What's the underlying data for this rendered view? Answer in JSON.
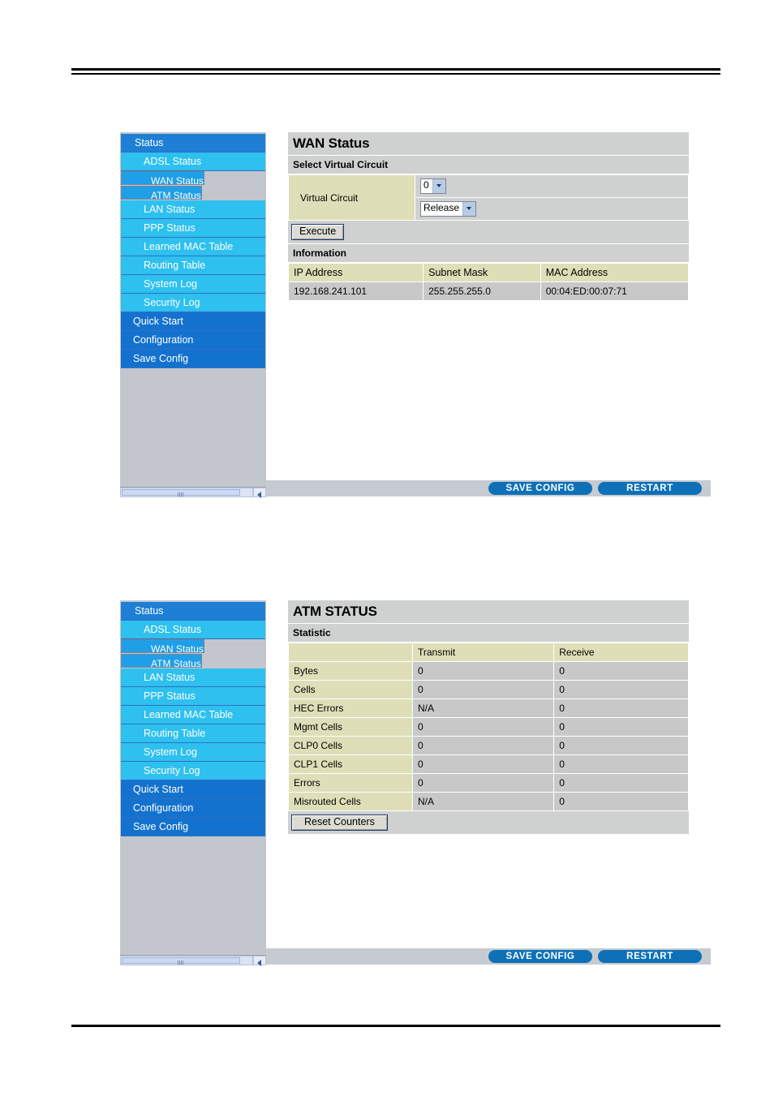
{
  "sidebar": {
    "items": [
      {
        "label": "Status",
        "level": 0,
        "selected": false
      },
      {
        "label": "ADSL Status",
        "level": 1,
        "selected": false
      },
      {
        "label": "WAN Status",
        "level": 1,
        "selected": true
      },
      {
        "label": "ATM Status",
        "level": 1,
        "selected": true
      },
      {
        "label": "LAN Status",
        "level": 1,
        "selected": false
      },
      {
        "label": "PPP Status",
        "level": 1,
        "selected": false
      },
      {
        "label": "Learned MAC Table",
        "level": 1,
        "selected": false
      },
      {
        "label": "Routing Table",
        "level": 1,
        "selected": false
      },
      {
        "label": "System Log",
        "level": 1,
        "selected": false
      },
      {
        "label": "Security Log",
        "level": 1,
        "selected": false
      },
      {
        "label": "Quick Start",
        "level": 2,
        "selected": false
      },
      {
        "label": "Configuration",
        "level": 2,
        "selected": false
      },
      {
        "label": "Save Config",
        "level": 2,
        "selected": false
      }
    ]
  },
  "footer": {
    "save_config_label": "SAVE CONFIG",
    "restart_label": "RESTART"
  },
  "wan_panel": {
    "title": "WAN Status",
    "section_select": "Select Virtual Circuit",
    "vc_label": "Virtual Circuit",
    "vc_value": "0",
    "action_value": "Release",
    "execute_label": "Execute",
    "section_information": "Information",
    "info_headers": [
      "IP Address",
      "Subnet Mask",
      "MAC Address"
    ],
    "info_row": [
      "192.168.241.101",
      "255.255.255.0",
      "00:04:ED:00:07:71"
    ]
  },
  "atm_panel": {
    "title": "ATM STATUS",
    "section_statistic": "Statistic",
    "col_blank": "",
    "col_transmit": "Transmit",
    "col_receive": "Receive",
    "reset_label": "Reset Counters",
    "rows": [
      {
        "name": "Bytes",
        "transmit": "0",
        "receive": "0"
      },
      {
        "name": "Cells",
        "transmit": "0",
        "receive": "0"
      },
      {
        "name": "HEC Errors",
        "transmit": "N/A",
        "receive": "0"
      },
      {
        "name": "Mgmt Cells",
        "transmit": "0",
        "receive": "0"
      },
      {
        "name": "CLP0 Cells",
        "transmit": "0",
        "receive": "0"
      },
      {
        "name": "CLP1 Cells",
        "transmit": "0",
        "receive": "0"
      },
      {
        "name": "Errors",
        "transmit": "0",
        "receive": "0"
      },
      {
        "name": "Misrouted Cells",
        "transmit": "N/A",
        "receive": "0"
      }
    ]
  }
}
